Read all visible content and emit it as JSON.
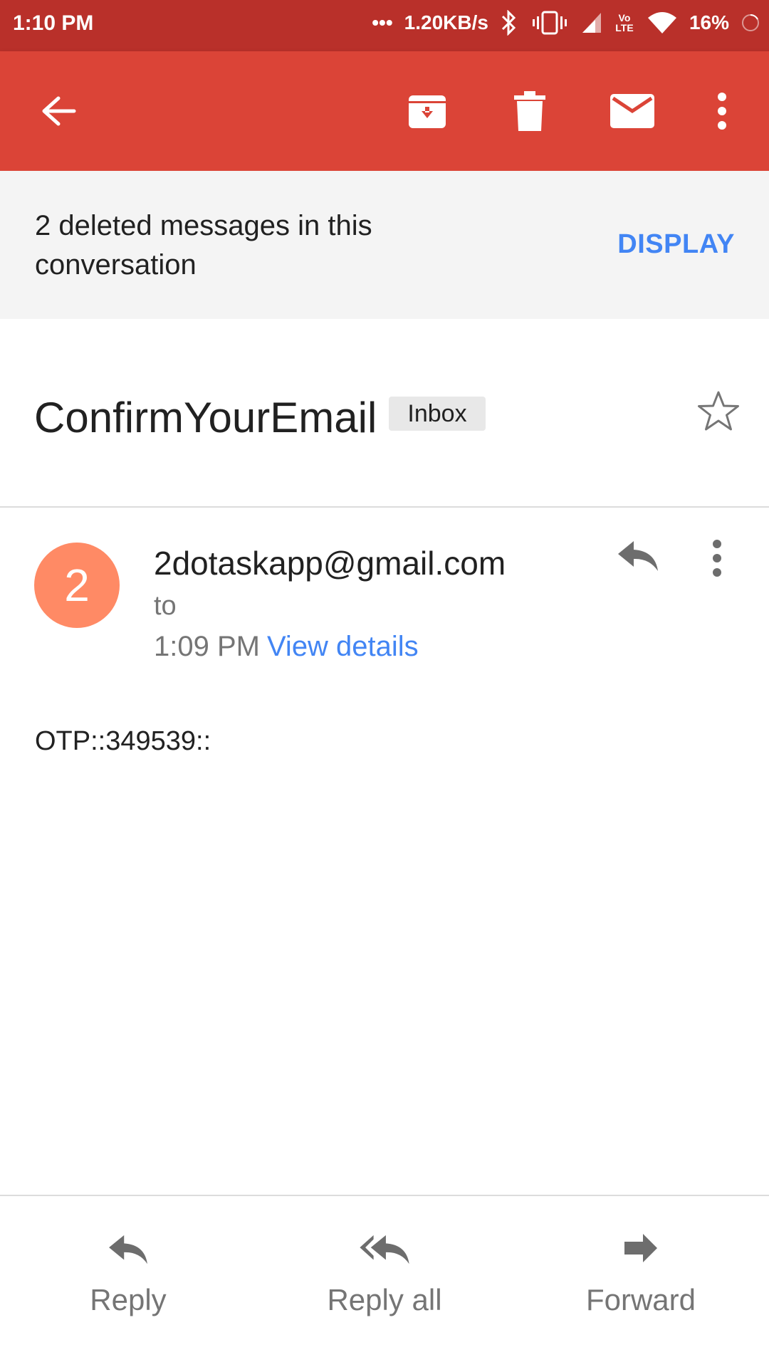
{
  "status_bar": {
    "time": "1:10 PM",
    "dots": "•••",
    "speed": "1.20KB/s",
    "volte": "Vo LTE",
    "battery": "16%"
  },
  "app_bar": {
    "icons": [
      "back-arrow-icon",
      "archive-icon",
      "delete-icon",
      "mark-unread-icon",
      "more-vert-icon"
    ],
    "color": "#db4437"
  },
  "banner": {
    "text": "2 deleted messages in this conversation",
    "action": "DISPLAY"
  },
  "message": {
    "subject": "ConfirmYourEmail",
    "label": "Inbox",
    "avatar_letter": "2",
    "avatar_color": "#ff8a65",
    "sender": "2dotaskapp@gmail.com",
    "to": "to",
    "time": "1:09 PM",
    "details_link": "View details",
    "body": "OTP::349539::"
  },
  "actions": {
    "reply": "Reply",
    "reply_all": "Reply all",
    "forward": "Forward"
  }
}
